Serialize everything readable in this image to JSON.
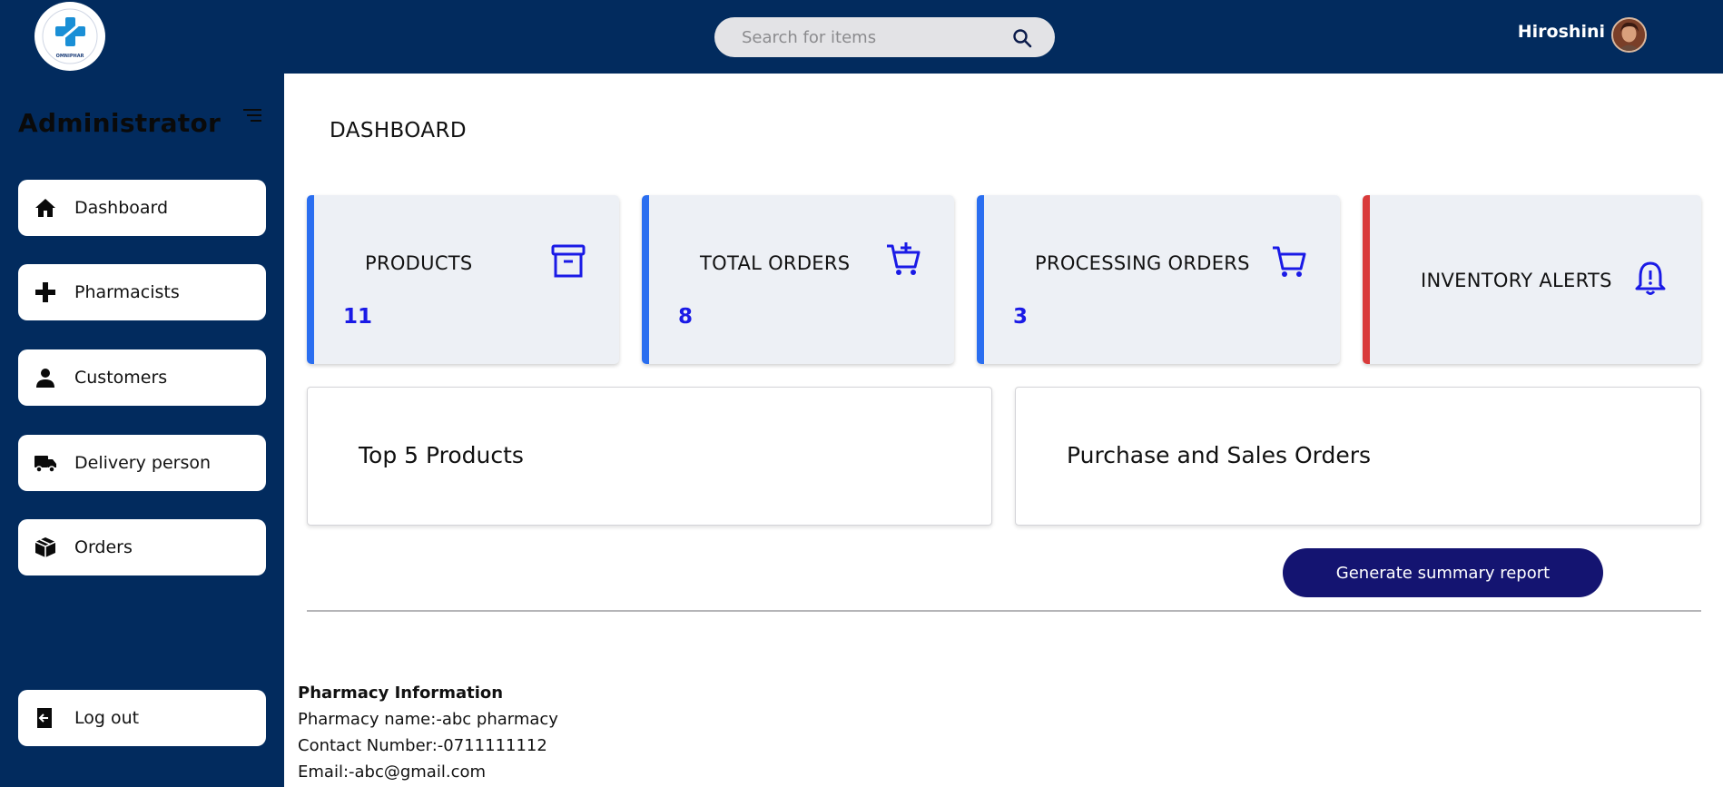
{
  "header": {
    "search_placeholder": "Search for items",
    "user_name": "Hiroshini",
    "logo_text": "OMNIPHAR"
  },
  "sidebar": {
    "role_title": "Administrator",
    "items": [
      {
        "label": "Dashboard",
        "icon": "home-icon"
      },
      {
        "label": "Pharmacists",
        "icon": "plus-icon"
      },
      {
        "label": "Customers",
        "icon": "person-icon"
      },
      {
        "label": "Delivery person",
        "icon": "truck-icon"
      },
      {
        "label": "Orders",
        "icon": "box-icon"
      }
    ],
    "logout_label": "Log out"
  },
  "main": {
    "title": "DASHBOARD",
    "stats": [
      {
        "label": "PRODUCTS",
        "value": "11",
        "icon": "archive-icon",
        "accent": "#2a6ef0"
      },
      {
        "label": "TOTAL ORDERS",
        "value": "8",
        "icon": "cart-plus-icon",
        "accent": "#2a6ef0"
      },
      {
        "label": "PROCESSING ORDERS",
        "value": "3",
        "icon": "cart-icon",
        "accent": "#2a6ef0"
      },
      {
        "label": "INVENTORY ALERTS",
        "value": "",
        "icon": "bell-alert-icon",
        "accent": "#d93a3a"
      }
    ],
    "panels": [
      {
        "title": "Top 5 Products"
      },
      {
        "title": "Purchase and Sales Orders"
      }
    ],
    "report_button": "Generate summary report"
  },
  "footer": {
    "title": "Pharmacy Information",
    "name": "Pharmacy name:-abc pharmacy",
    "contact": "Contact Number:-0711111112",
    "email": "Email:-abc@gmail.com"
  },
  "colors": {
    "navy": "#022b5e",
    "accent_blue": "#2a6ef0",
    "alert_red": "#d93a3a",
    "button_navy": "#141471",
    "stat_value_blue": "#1a1ae6"
  }
}
